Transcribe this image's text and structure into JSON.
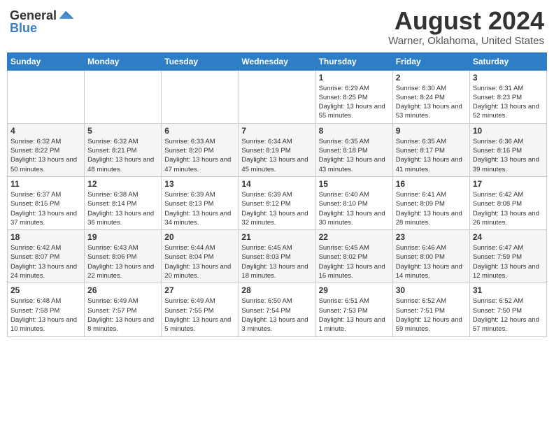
{
  "header": {
    "logo": {
      "general": "General",
      "blue": "Blue"
    },
    "title": "August 2024",
    "subtitle": "Warner, Oklahoma, United States"
  },
  "days_of_week": [
    "Sunday",
    "Monday",
    "Tuesday",
    "Wednesday",
    "Thursday",
    "Friday",
    "Saturday"
  ],
  "weeks": [
    [
      {
        "day": "",
        "info": ""
      },
      {
        "day": "",
        "info": ""
      },
      {
        "day": "",
        "info": ""
      },
      {
        "day": "",
        "info": ""
      },
      {
        "day": "1",
        "sunrise": "6:29 AM",
        "sunset": "8:25 PM",
        "daylight": "13 hours and 55 minutes."
      },
      {
        "day": "2",
        "sunrise": "6:30 AM",
        "sunset": "8:24 PM",
        "daylight": "13 hours and 53 minutes."
      },
      {
        "day": "3",
        "sunrise": "6:31 AM",
        "sunset": "8:23 PM",
        "daylight": "13 hours and 52 minutes."
      }
    ],
    [
      {
        "day": "4",
        "sunrise": "6:32 AM",
        "sunset": "8:22 PM",
        "daylight": "13 hours and 50 minutes."
      },
      {
        "day": "5",
        "sunrise": "6:32 AM",
        "sunset": "8:21 PM",
        "daylight": "13 hours and 48 minutes."
      },
      {
        "day": "6",
        "sunrise": "6:33 AM",
        "sunset": "8:20 PM",
        "daylight": "13 hours and 47 minutes."
      },
      {
        "day": "7",
        "sunrise": "6:34 AM",
        "sunset": "8:19 PM",
        "daylight": "13 hours and 45 minutes."
      },
      {
        "day": "8",
        "sunrise": "6:35 AM",
        "sunset": "8:18 PM",
        "daylight": "13 hours and 43 minutes."
      },
      {
        "day": "9",
        "sunrise": "6:35 AM",
        "sunset": "8:17 PM",
        "daylight": "13 hours and 41 minutes."
      },
      {
        "day": "10",
        "sunrise": "6:36 AM",
        "sunset": "8:16 PM",
        "daylight": "13 hours and 39 minutes."
      }
    ],
    [
      {
        "day": "11",
        "sunrise": "6:37 AM",
        "sunset": "8:15 PM",
        "daylight": "13 hours and 37 minutes."
      },
      {
        "day": "12",
        "sunrise": "6:38 AM",
        "sunset": "8:14 PM",
        "daylight": "13 hours and 36 minutes."
      },
      {
        "day": "13",
        "sunrise": "6:39 AM",
        "sunset": "8:13 PM",
        "daylight": "13 hours and 34 minutes."
      },
      {
        "day": "14",
        "sunrise": "6:39 AM",
        "sunset": "8:12 PM",
        "daylight": "13 hours and 32 minutes."
      },
      {
        "day": "15",
        "sunrise": "6:40 AM",
        "sunset": "8:10 PM",
        "daylight": "13 hours and 30 minutes."
      },
      {
        "day": "16",
        "sunrise": "6:41 AM",
        "sunset": "8:09 PM",
        "daylight": "13 hours and 28 minutes."
      },
      {
        "day": "17",
        "sunrise": "6:42 AM",
        "sunset": "8:08 PM",
        "daylight": "13 hours and 26 minutes."
      }
    ],
    [
      {
        "day": "18",
        "sunrise": "6:42 AM",
        "sunset": "8:07 PM",
        "daylight": "13 hours and 24 minutes."
      },
      {
        "day": "19",
        "sunrise": "6:43 AM",
        "sunset": "8:06 PM",
        "daylight": "13 hours and 22 minutes."
      },
      {
        "day": "20",
        "sunrise": "6:44 AM",
        "sunset": "8:04 PM",
        "daylight": "13 hours and 20 minutes."
      },
      {
        "day": "21",
        "sunrise": "6:45 AM",
        "sunset": "8:03 PM",
        "daylight": "13 hours and 18 minutes."
      },
      {
        "day": "22",
        "sunrise": "6:45 AM",
        "sunset": "8:02 PM",
        "daylight": "13 hours and 16 minutes."
      },
      {
        "day": "23",
        "sunrise": "6:46 AM",
        "sunset": "8:00 PM",
        "daylight": "13 hours and 14 minutes."
      },
      {
        "day": "24",
        "sunrise": "6:47 AM",
        "sunset": "7:59 PM",
        "daylight": "13 hours and 12 minutes."
      }
    ],
    [
      {
        "day": "25",
        "sunrise": "6:48 AM",
        "sunset": "7:58 PM",
        "daylight": "13 hours and 10 minutes."
      },
      {
        "day": "26",
        "sunrise": "6:49 AM",
        "sunset": "7:57 PM",
        "daylight": "13 hours and 8 minutes."
      },
      {
        "day": "27",
        "sunrise": "6:49 AM",
        "sunset": "7:55 PM",
        "daylight": "13 hours and 5 minutes."
      },
      {
        "day": "28",
        "sunrise": "6:50 AM",
        "sunset": "7:54 PM",
        "daylight": "13 hours and 3 minutes."
      },
      {
        "day": "29",
        "sunrise": "6:51 AM",
        "sunset": "7:53 PM",
        "daylight": "13 hours and 1 minute."
      },
      {
        "day": "30",
        "sunrise": "6:52 AM",
        "sunset": "7:51 PM",
        "daylight": "12 hours and 59 minutes."
      },
      {
        "day": "31",
        "sunrise": "6:52 AM",
        "sunset": "7:50 PM",
        "daylight": "12 hours and 57 minutes."
      }
    ]
  ],
  "labels": {
    "sunrise": "Sunrise:",
    "sunset": "Sunset:",
    "daylight": "Daylight:"
  }
}
